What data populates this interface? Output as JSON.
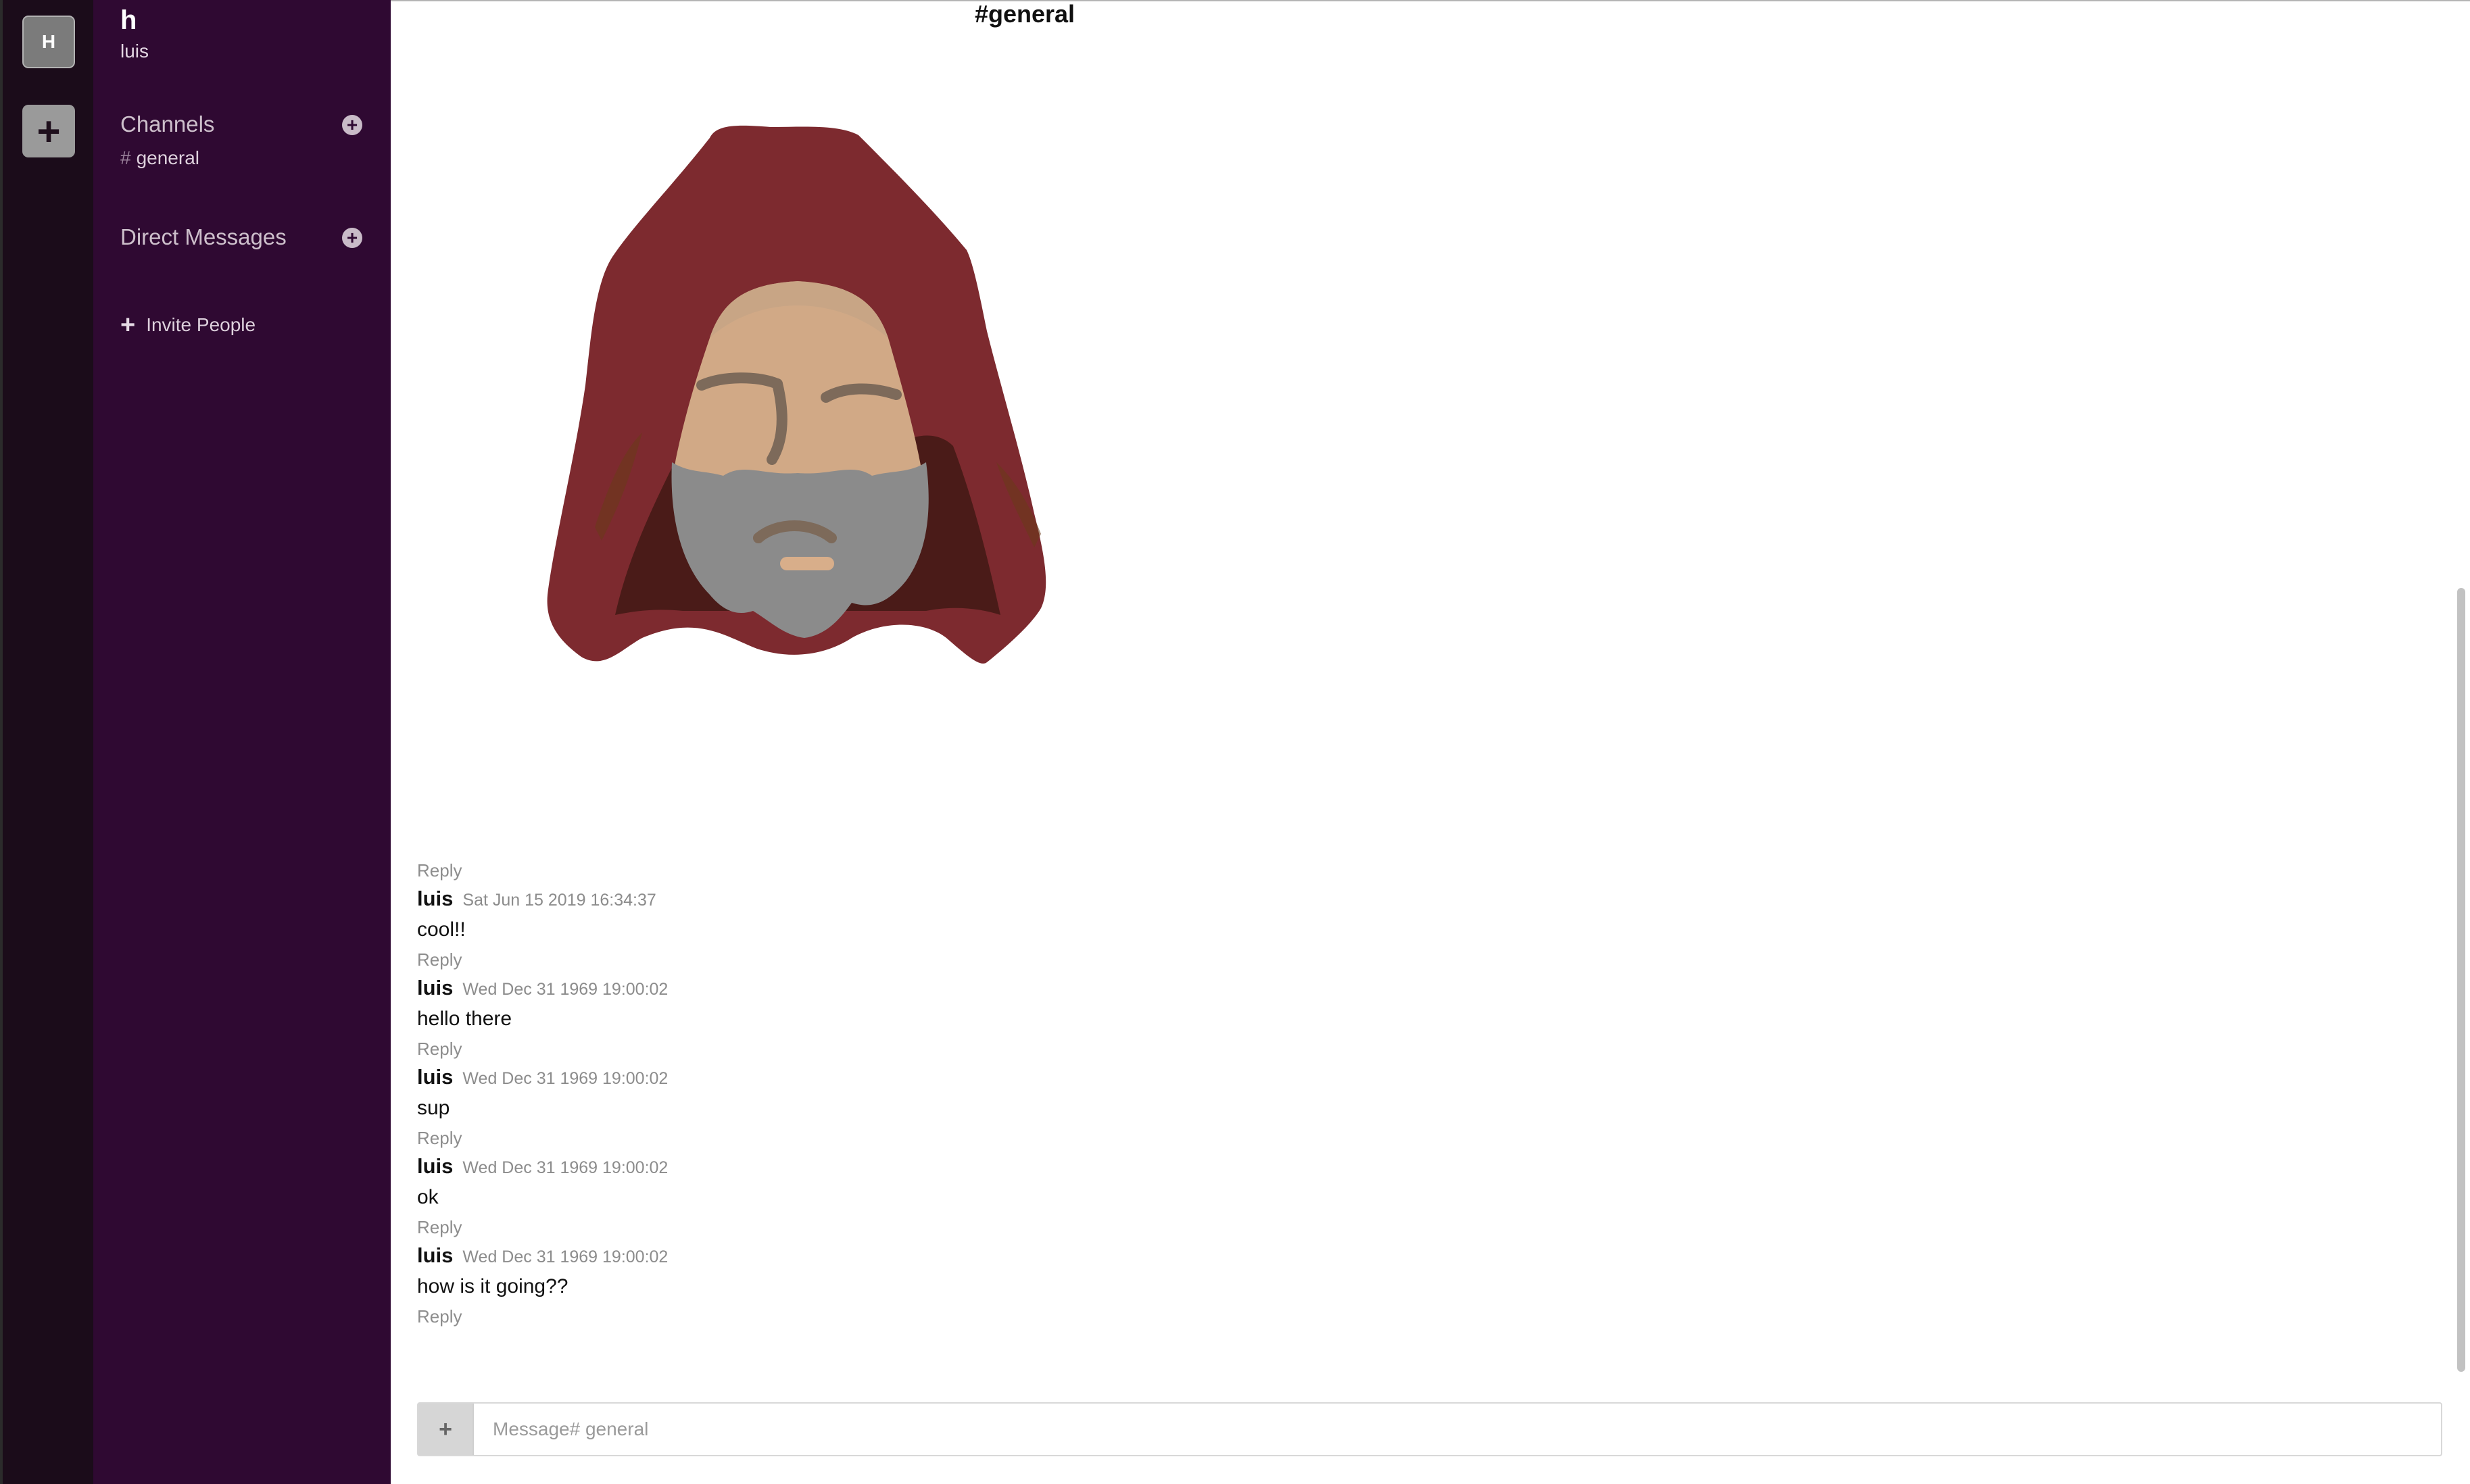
{
  "team_rail": {
    "team_letter": "H",
    "add_team_label": "+"
  },
  "sidebar": {
    "team_name": "h",
    "username": "luis",
    "channels_title": "Channels",
    "channels": [
      {
        "hash": "#",
        "name": "general"
      }
    ],
    "dms_title": "Direct Messages",
    "add_icon_label": "+",
    "invite_plus": "+",
    "invite_label": "Invite People"
  },
  "header": {
    "title": "#general"
  },
  "messages": {
    "reply_label": "Reply",
    "items": [
      {
        "author": "luis",
        "time": "Sat Jun 15 2019 16:34:37",
        "text": "cool!!"
      },
      {
        "author": "luis",
        "time": "Wed Dec 31 1969 19:00:02",
        "text": "hello there"
      },
      {
        "author": "luis",
        "time": "Wed Dec 31 1969 19:00:02",
        "text": "sup"
      },
      {
        "author": "luis",
        "time": "Wed Dec 31 1969 19:00:02",
        "text": "ok"
      },
      {
        "author": "luis",
        "time": "Wed Dec 31 1969 19:00:02",
        "text": "how is it going??"
      }
    ]
  },
  "composer": {
    "attach_label": "+",
    "placeholder": "Message# general"
  },
  "colors": {
    "sidebar_bg": "#2f0932",
    "team_rail_bg": "#1b0c1a",
    "hood": "#7d2a2f",
    "skin": "#d1a986",
    "beard": "#8b8b8b"
  }
}
